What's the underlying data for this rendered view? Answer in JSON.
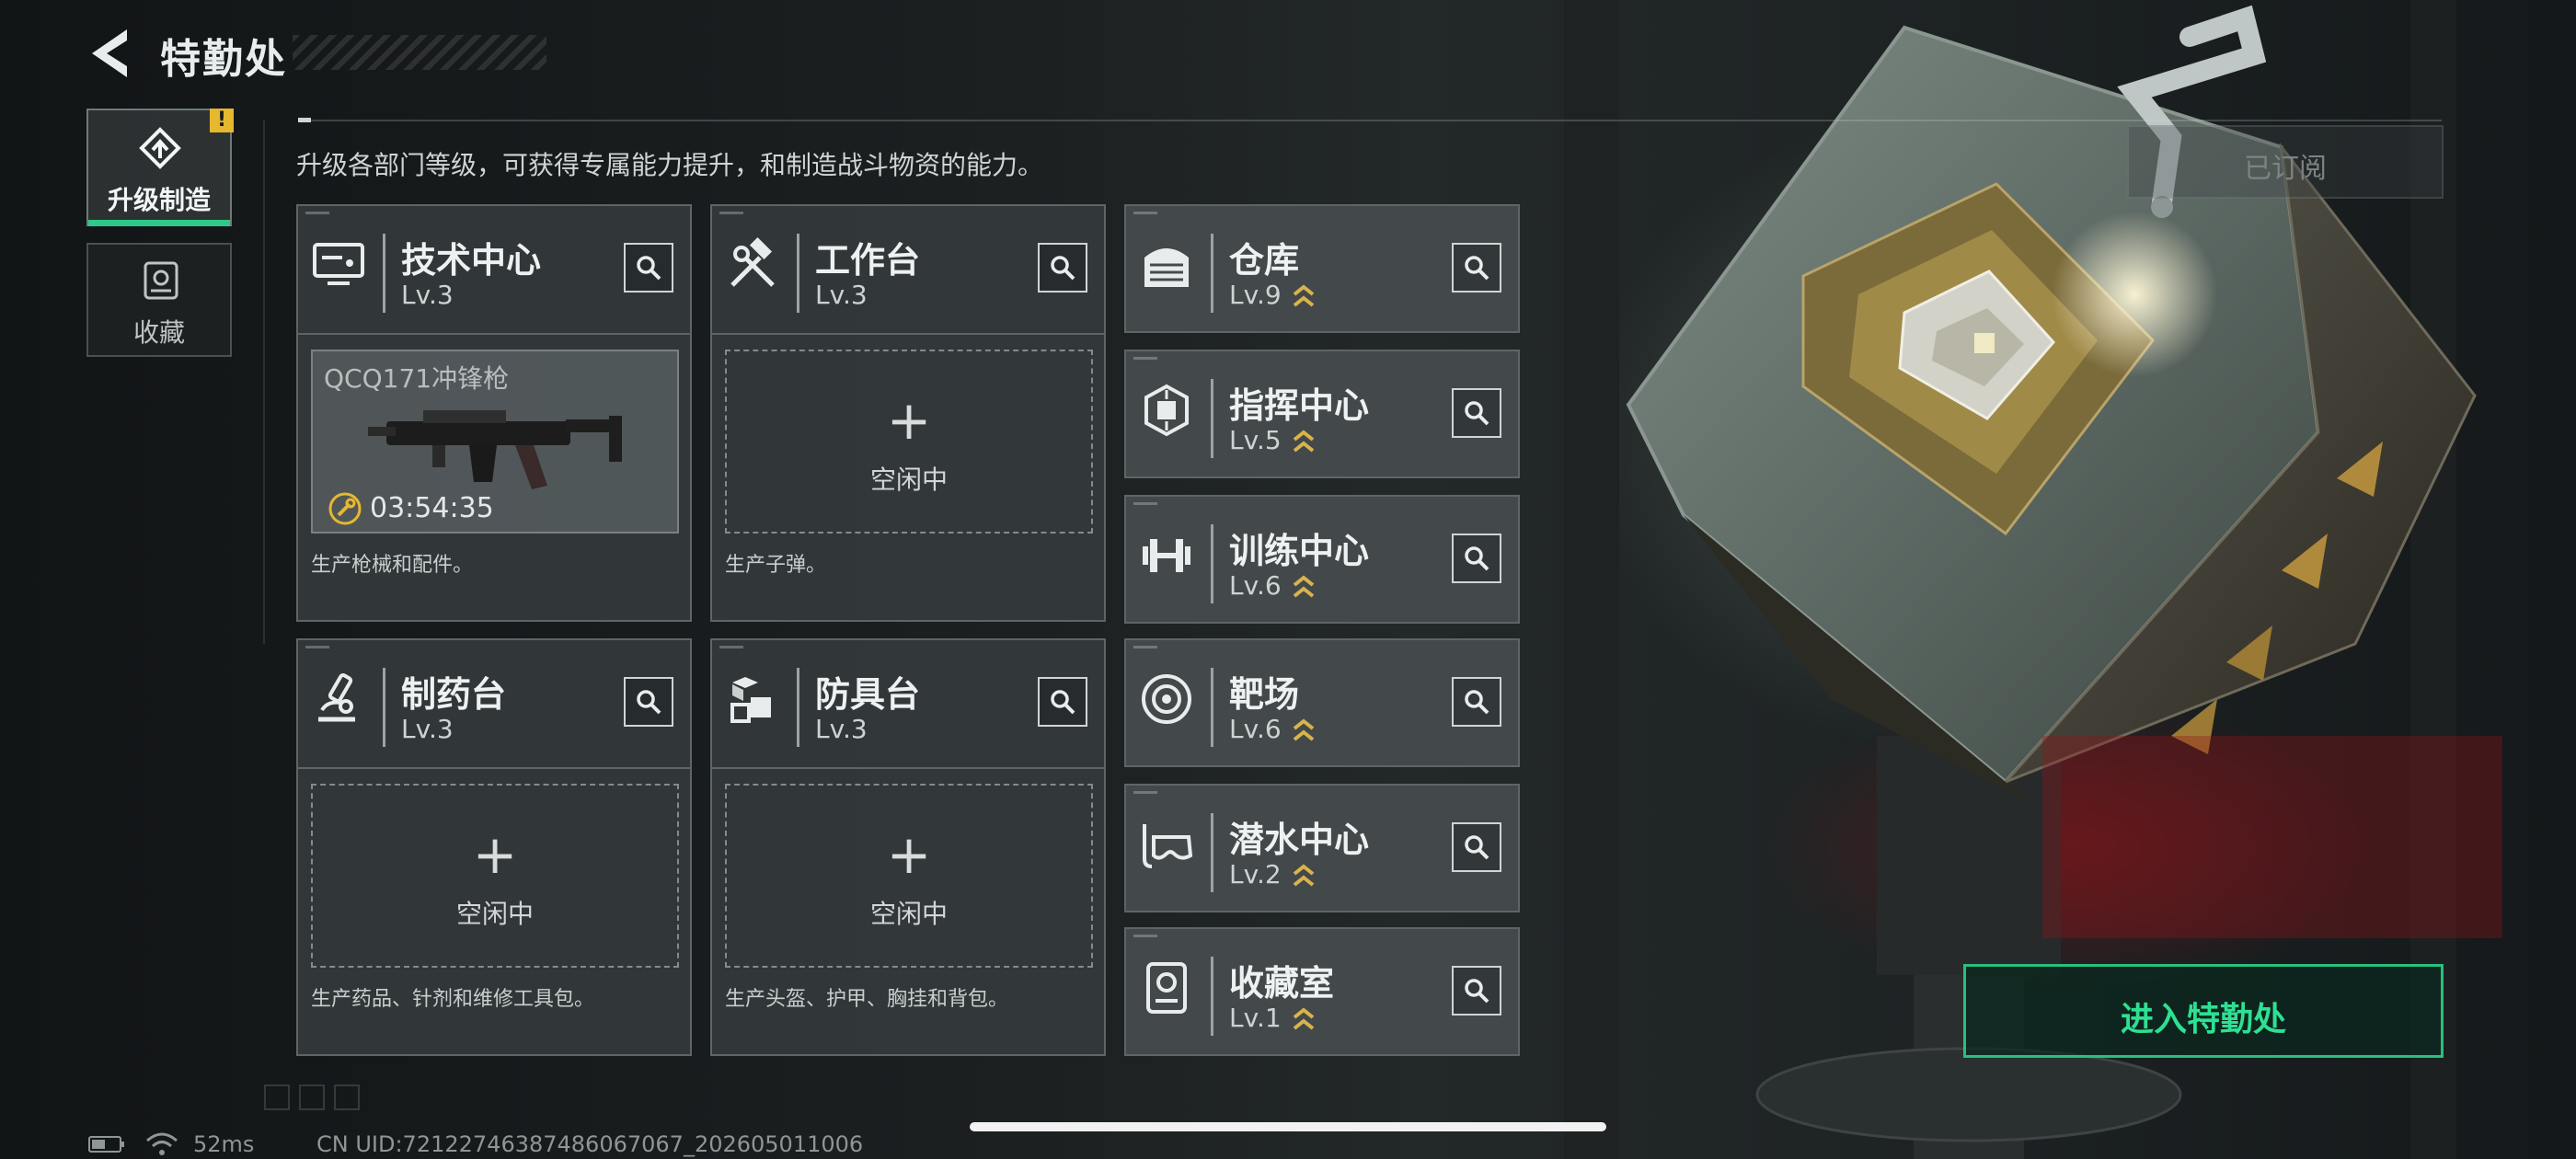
{
  "header": {
    "title": "特勤处",
    "back_icon": "back-arrow-icon"
  },
  "sidebar": {
    "items": [
      {
        "label": "升级制造",
        "icon": "upgrade-build-icon",
        "active": true,
        "alert_badge": "!"
      },
      {
        "label": "收藏",
        "icon": "collection-icon",
        "active": false
      }
    ]
  },
  "subtitle": "升级各部门等级，可获得专属能力提升，和制造战斗物资的能力。",
  "departments": [
    {
      "name": "技术中心",
      "level": "Lv.3",
      "icon": "tech-center-icon",
      "slot": {
        "state": "producing",
        "item": "QCQ171冲锋枪",
        "timer": "03:54:35"
      },
      "description": "生产枪械和配件。"
    },
    {
      "name": "工作台",
      "level": "Lv.3",
      "icon": "workbench-tools-icon",
      "slot": {
        "state": "idle",
        "label": "空闲中"
      },
      "description": "生产子弹。"
    },
    {
      "name": "制药台",
      "level": "Lv.3",
      "icon": "microscope-icon",
      "slot": {
        "state": "idle",
        "label": "空闲中"
      },
      "description": "生产药品、针剂和维修工具包。"
    },
    {
      "name": "防具台",
      "level": "Lv.3",
      "icon": "armor-blocks-icon",
      "slot": {
        "state": "idle",
        "label": "空闲中"
      },
      "description": "生产头盔、护甲、胸挂和背包。"
    }
  ],
  "facilities": [
    {
      "name": "仓库",
      "level": "Lv.9",
      "icon": "warehouse-icon",
      "upgradable": true
    },
    {
      "name": "指挥中心",
      "level": "Lv.5",
      "icon": "command-chip-icon",
      "upgradable": true
    },
    {
      "name": "训练中心",
      "level": "Lv.6",
      "icon": "dumbbell-icon",
      "upgradable": true
    },
    {
      "name": "靶场",
      "level": "Lv.6",
      "icon": "target-icon",
      "upgradable": true
    },
    {
      "name": "潜水中心",
      "level": "Lv.2",
      "icon": "diving-mask-icon",
      "upgradable": true
    },
    {
      "name": "收藏室",
      "level": "Lv.1",
      "icon": "collection-room-icon",
      "upgradable": true
    }
  ],
  "subscribed_label": "已订阅",
  "enter_button": "进入特勤处",
  "status": {
    "ping": "52ms",
    "uid": "CN UID:72122746387486067067_202605011006"
  },
  "colors": {
    "accent_green": "#2ee092",
    "badge_yellow": "#e6b830",
    "upgrade_gold": "#d9b44a"
  }
}
